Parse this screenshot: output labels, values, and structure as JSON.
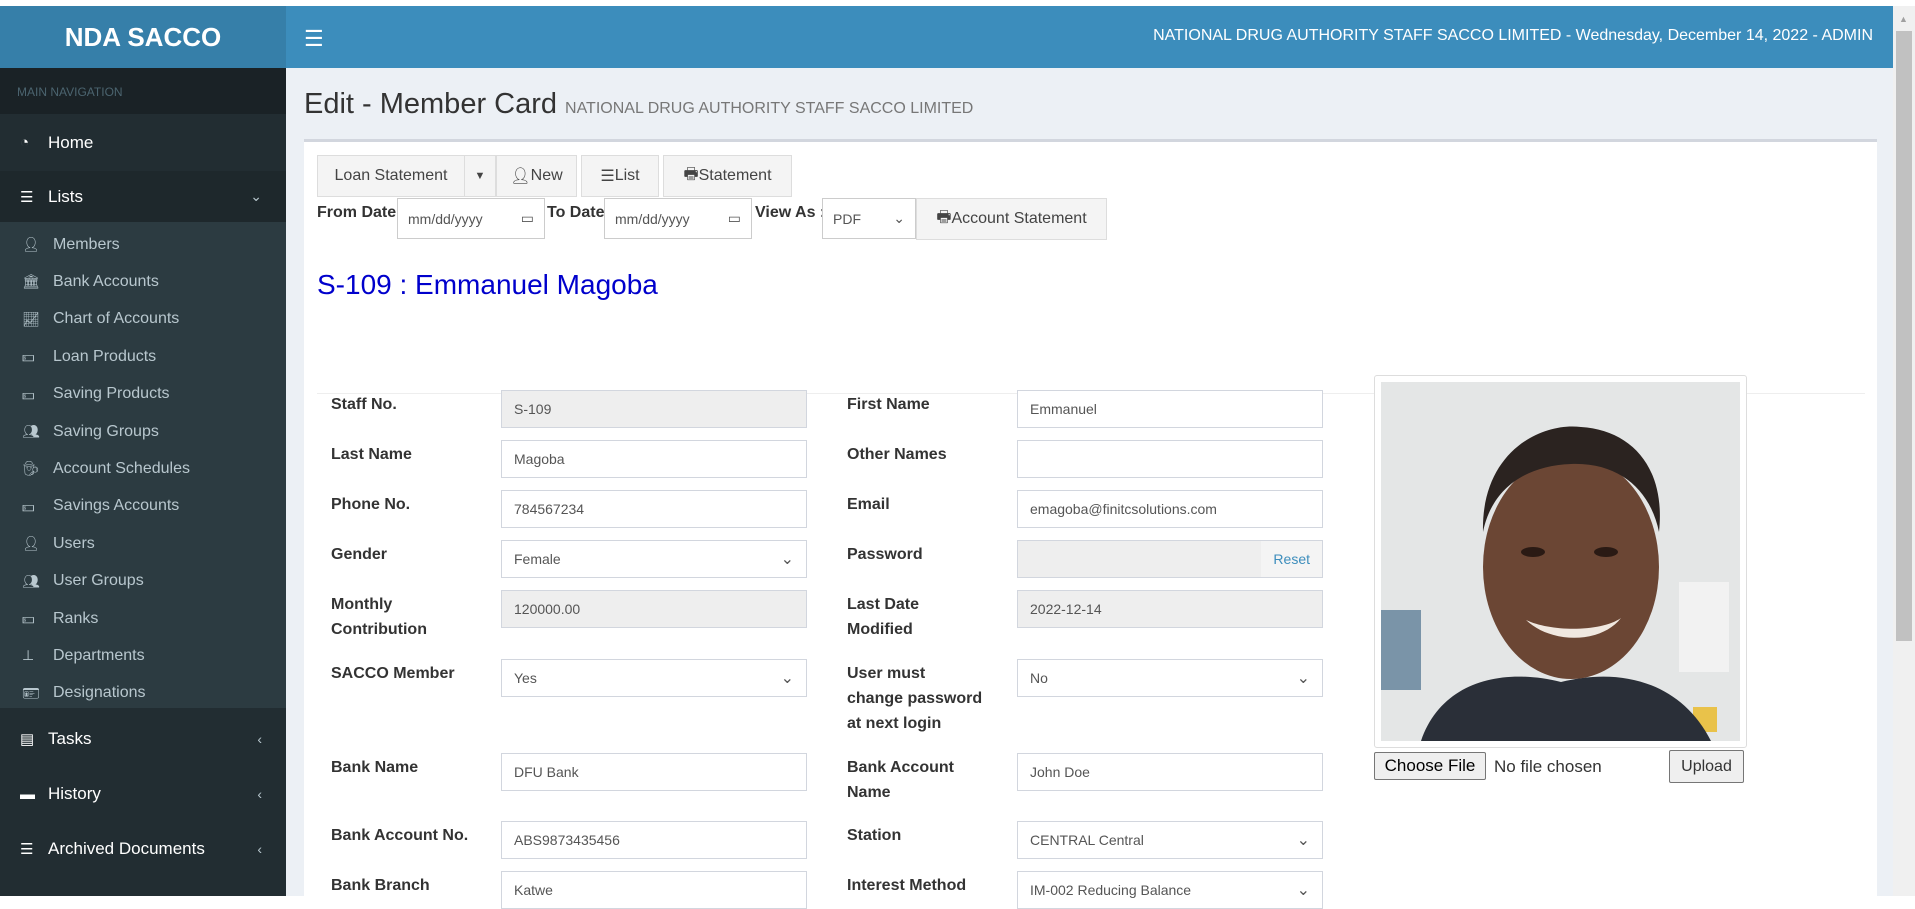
{
  "brand": "NDA SACCO",
  "header": {
    "text": "NATIONAL DRUG AUTHORITY STAFF SACCO LIMITED - Wednesday, December 14, 2022 - ADMIN",
    "menu_icon": "☰"
  },
  "sidebar": {
    "nav_label": "MAIN NAVIGATION",
    "home": "Home",
    "lists": "Lists",
    "sub_items": [
      {
        "label": "Members",
        "icon": "user"
      },
      {
        "label": "Bank Accounts",
        "icon": "bank"
      },
      {
        "label": "Chart of Accounts",
        "icon": "chart"
      },
      {
        "label": "Loan Products",
        "icon": "money"
      },
      {
        "label": "Saving Products",
        "icon": "money"
      },
      {
        "label": "Saving Groups",
        "icon": "users"
      },
      {
        "label": "Account Schedules",
        "icon": "user-secret"
      },
      {
        "label": "Savings Accounts",
        "icon": "money"
      },
      {
        "label": "Users",
        "icon": "user"
      },
      {
        "label": "User Groups",
        "icon": "users"
      },
      {
        "label": "Ranks",
        "icon": "money"
      },
      {
        "label": "Departments",
        "icon": "sitemap"
      },
      {
        "label": "Designations",
        "icon": "id-card"
      }
    ],
    "tasks": "Tasks",
    "history": "History",
    "archived": "Archived Documents"
  },
  "page": {
    "title": "Edit - Member Card",
    "subtitle": "NATIONAL DRUG AUTHORITY STAFF SACCO LIMITED"
  },
  "toolbar": {
    "loan_statement": "Loan Statement",
    "new": "New",
    "list": "List",
    "statement": "Statement",
    "from_date": "From Date",
    "to_date": "To Date",
    "date_placeholder": "mm/dd/yyyy",
    "view_as": "View As :",
    "view_as_value": "PDF",
    "account_statement": "Account Statement"
  },
  "member_title": "S-109 : Emmanuel Magoba",
  "form": {
    "staff_no": {
      "label": "Staff No.",
      "value": "S-109"
    },
    "first_name": {
      "label": "First Name",
      "value": "Emmanuel"
    },
    "last_name": {
      "label": "Last Name",
      "value": "Magoba"
    },
    "other_names": {
      "label": "Other Names",
      "value": ""
    },
    "phone": {
      "label": "Phone No.",
      "value": "784567234"
    },
    "email": {
      "label": "Email",
      "value": "emagoba@finitcsolutions.com"
    },
    "gender": {
      "label": "Gender",
      "value": "Female"
    },
    "password": {
      "label": "Password",
      "value": "",
      "reset": "Reset"
    },
    "monthly_contribution": {
      "label1": "Monthly",
      "label2": "Contribution",
      "value": "120000.00"
    },
    "last_modified": {
      "label1": "Last Date",
      "label2": "Modified",
      "value": "2022-12-14"
    },
    "sacco_member": {
      "label": "SACCO Member",
      "value": "Yes"
    },
    "must_change": {
      "label1": "User must",
      "label2": "change password",
      "label3": "at next login",
      "value": "No"
    },
    "bank_name": {
      "label": "Bank Name",
      "value": "DFU Bank"
    },
    "bank_account_name": {
      "label1": "Bank Account",
      "label2": "Name",
      "value": "John Doe"
    },
    "bank_account_no": {
      "label": "Bank Account No.",
      "value": "ABS9873435456"
    },
    "station": {
      "label": "Station",
      "value": "CENTRAL Central"
    },
    "bank_branch": {
      "label": "Bank Branch",
      "value": "Katwe"
    },
    "interest_method": {
      "label": "Interest Method",
      "value": "IM-002 Reducing Balance"
    }
  },
  "photo": {
    "choose_file": "Choose File",
    "no_file": "No file chosen",
    "upload": "Upload"
  }
}
